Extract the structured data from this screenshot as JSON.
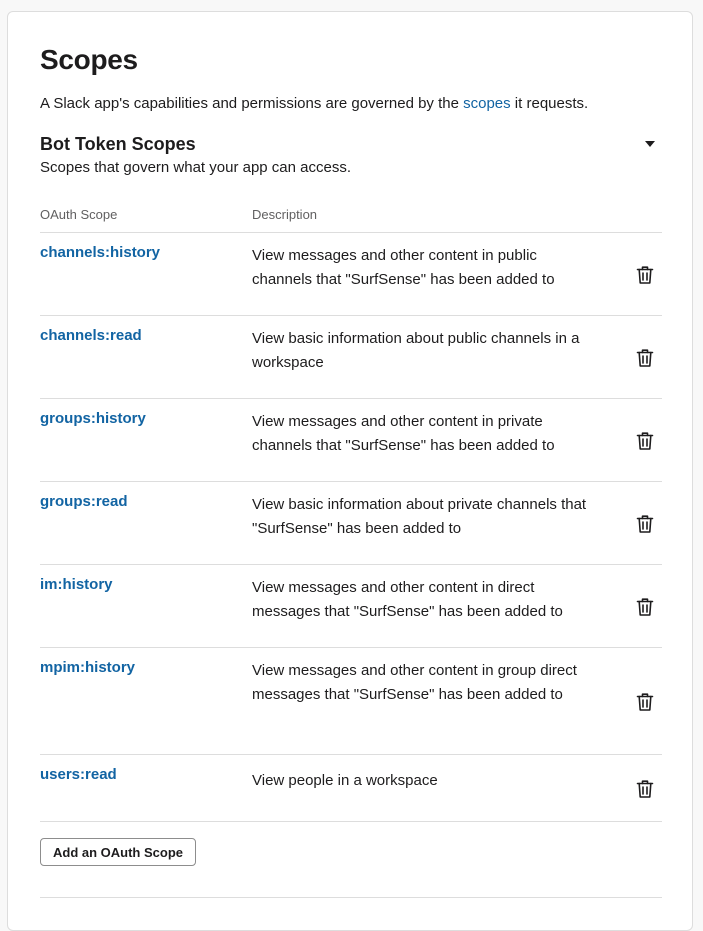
{
  "page": {
    "title": "Scopes",
    "intro_prefix": "A Slack app's capabilities and permissions are governed by the ",
    "intro_link": "scopes",
    "intro_suffix": " it requests."
  },
  "bot_section": {
    "title": "Bot Token Scopes",
    "subtitle": "Scopes that govern what your app can access.",
    "collapse_icon": "caret-down-icon",
    "columns": {
      "scope": "OAuth Scope",
      "description": "Description"
    },
    "rows": [
      {
        "scope": "channels:history",
        "description": "View messages and other content in public channels that \"SurfSense\" has been added to"
      },
      {
        "scope": "channels:read",
        "description": "View basic information about public channels in a workspace"
      },
      {
        "scope": "groups:history",
        "description": "View messages and other content in private channels that \"SurfSense\" has been added to"
      },
      {
        "scope": "groups:read",
        "description": "View basic information about private channels that \"SurfSense\" has been added to"
      },
      {
        "scope": "im:history",
        "description": "View messages and other content in direct messages that \"SurfSense\" has been added to"
      },
      {
        "scope": "mpim:history",
        "description": "View messages and other content in group direct messages that \"SurfSense\" has been added to"
      },
      {
        "scope": "users:read",
        "description": "View people in a workspace"
      }
    ],
    "row_action_icon": "trash-icon",
    "add_button_label": "Add an OAuth Scope"
  },
  "colors": {
    "link": "#1264a3",
    "text": "#1d1c1d",
    "muted": "#616061",
    "divider": "#dddddd"
  }
}
